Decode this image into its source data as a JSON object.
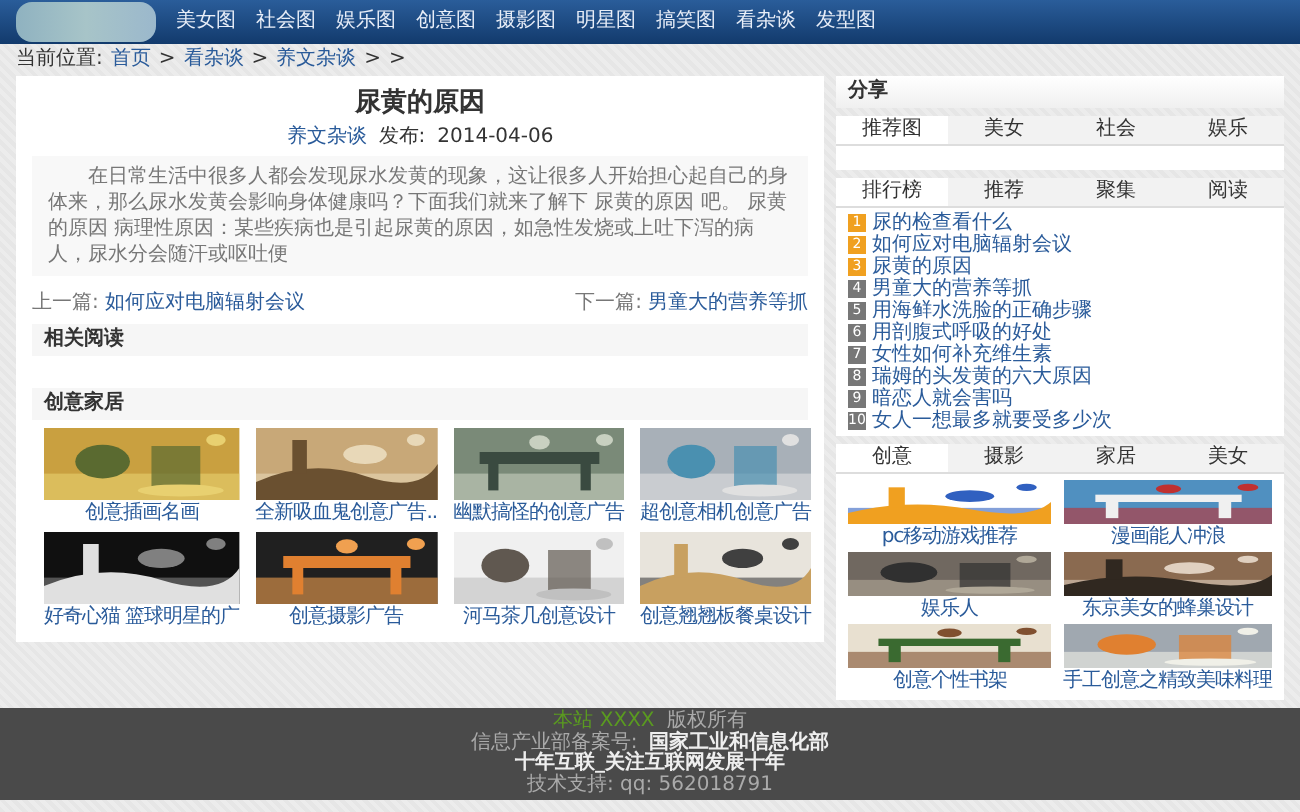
{
  "header": {
    "nav": [
      "美女图",
      "社会图",
      "娱乐图",
      "创意图",
      "摄影图",
      "明星图",
      "搞笑图",
      "看杂谈",
      "发型图"
    ]
  },
  "breadcrumb": [
    "当前位置:",
    "首页",
    ">",
    "看杂谈",
    ">",
    "养文杂谈",
    ">",
    ">"
  ],
  "article": {
    "title": "尿黄的原因",
    "category": "养文杂谈",
    "published_label": "发布:",
    "date": "2014-04-06",
    "body": "在日常生活中很多人都会发现尿水发黄的现象，这让很多人开始担心起自己的身体来，那么尿水发黄会影响身体健康吗？下面我们就来了解下 尿黄的原因 吧。 尿黄的原因 病理性原因：某些疾病也是引起尿黄的原因，如急性发烧或上吐下泻的病人，尿水分会随汗或呕吐便",
    "prev": {
      "label": "上一篇:",
      "title": "如何应对电脑辐射会议"
    },
    "next": {
      "label": "下一篇:",
      "title": "男童大的营养等抓"
    }
  },
  "related": {
    "title": "相关阅读"
  },
  "gallery": {
    "title": "创意家居",
    "items": [
      {
        "kind": "picture",
        "caption": "创意插画名画"
      },
      {
        "kind": "picture",
        "caption": "全新吸血鬼创意广告.."
      },
      {
        "kind": "picture",
        "caption": "幽默搞怪的创意广告"
      },
      {
        "kind": "picture",
        "caption": "超创意相机创意广告"
      },
      {
        "kind": "picture",
        "caption": "好奇心猫 篮球明星的广"
      },
      {
        "kind": "picture",
        "caption": "创意摄影广告"
      },
      {
        "kind": "picture",
        "caption": "河马茶几创意设计"
      },
      {
        "kind": "picture",
        "caption": "创意翘翘板餐桌设计"
      }
    ]
  },
  "sidebar": {
    "share": {
      "title": "分享"
    },
    "recommend_tabs": [
      {
        "label": "推荐图",
        "selected": true
      },
      {
        "label": "美女",
        "selected": false
      },
      {
        "label": "社会",
        "selected": false
      },
      {
        "label": "娱乐",
        "selected": false
      }
    ],
    "ranking_tabs": [
      {
        "label": "排行榜",
        "selected": true
      },
      {
        "label": "推荐",
        "selected": false
      },
      {
        "label": "聚集",
        "selected": false
      },
      {
        "label": "阅读",
        "selected": false
      }
    ],
    "ranking": [
      {
        "number": "1",
        "top": true,
        "title": "尿的检查看什么"
      },
      {
        "number": "2",
        "top": true,
        "title": "如何应对电脑辐射会议"
      },
      {
        "number": "3",
        "top": true,
        "title": "尿黄的原因"
      },
      {
        "number": "4",
        "top": false,
        "title": "男童大的营养等抓"
      },
      {
        "number": "5",
        "top": false,
        "title": "用海鲜水洗脸的正确步骤"
      },
      {
        "number": "6",
        "top": false,
        "title": "用剖腹式呼吸的好处"
      },
      {
        "number": "7",
        "top": false,
        "title": "女性如何补充维生素"
      },
      {
        "number": "8",
        "top": false,
        "title": "瑞姆的头发黄的六大原因"
      },
      {
        "number": "9",
        "top": false,
        "title": "暗恋人就会害吗"
      },
      {
        "number": "10",
        "top": false,
        "title": "女人一想最多就要受多少次"
      }
    ],
    "photo_tabs": [
      {
        "label": "创意",
        "selected": true
      },
      {
        "label": "摄影",
        "selected": false
      },
      {
        "label": "家居",
        "selected": false
      },
      {
        "label": "美女",
        "selected": false
      }
    ],
    "photos": [
      {
        "kind": "picture",
        "caption": "pc移动游戏推荐"
      },
      {
        "kind": "picture",
        "caption": "漫画能人冲浪"
      },
      {
        "kind": "picture",
        "caption": "娱乐人"
      },
      {
        "kind": "picture",
        "caption": "东京美女的蜂巢设计"
      },
      {
        "kind": "picture",
        "caption": "创意个性书架"
      },
      {
        "kind": "picture",
        "caption": "手工创意之精致美味料理"
      }
    ]
  },
  "footer": {
    "lines": [
      [
        {
          "text": "本站 XXXX",
          "kind": "highlight"
        },
        {
          "text": "版权所有",
          "kind": "plain"
        }
      ],
      [
        {
          "text": "信息产业部备案号:",
          "kind": "plain"
        },
        {
          "text": "国家工业和信息化部",
          "kind": "strong"
        }
      ],
      [
        {
          "text": "十年互联_关注互联网发展十年",
          "kind": "strong"
        }
      ],
      [
        {
          "text": "技术支持: qq: 562018791",
          "kind": "plain"
        }
      ]
    ]
  }
}
